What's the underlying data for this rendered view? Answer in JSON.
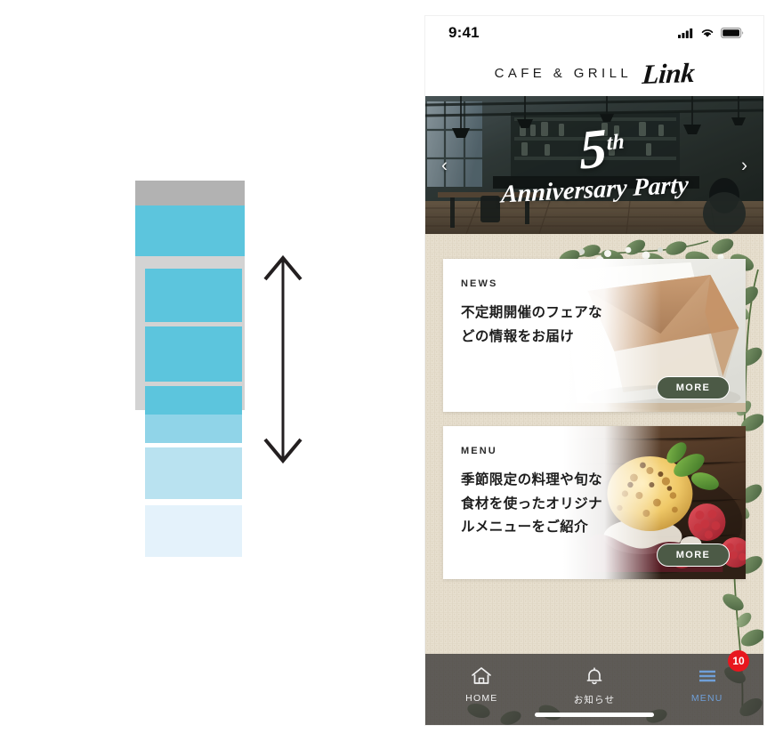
{
  "diagram": {
    "label": "scroll-depth-color-scale",
    "arrow": "double-headed-vertical-arrow",
    "blocks": [
      {
        "name": "gray-cap",
        "color": "#b2b2b2"
      },
      {
        "name": "blue-1",
        "color": "#5cc5dd"
      },
      {
        "name": "blue-2",
        "color": "#5cc5dd"
      },
      {
        "name": "blue-3",
        "color": "#5cc5dd"
      },
      {
        "name": "blue-4",
        "color": "#5cc5dd"
      },
      {
        "name": "blue-5",
        "color": "#90d4e8"
      },
      {
        "name": "blue-6",
        "color": "#b9e2f0"
      },
      {
        "name": "blue-7",
        "color": "#e4f2fb"
      }
    ],
    "backing_color": "#d3d3d3",
    "arrow_color": "#231f20"
  },
  "phone": {
    "statusbar": {
      "time": "9:41",
      "icons": [
        "cellular-signal-icon",
        "wifi-icon",
        "battery-icon"
      ]
    },
    "header": {
      "brand_prefix": "CAFE & GRILL",
      "brand_script": "Link"
    },
    "hero": {
      "number": "5",
      "ordinal": "th",
      "subtitle": "Anniversary Party",
      "prev_arrow": "‹",
      "next_arrow": "›"
    },
    "cards": [
      {
        "kicker": "NEWS",
        "title": "不定期開催のフェアなどの情報をお届け",
        "more_label": "MORE",
        "photo": "envelope-photo"
      },
      {
        "kicker": "MENU",
        "title": "季節限定の料理や旬な食材を使ったオリジナルメニューをご紹介",
        "more_label": "MORE",
        "photo": "dessert-photo"
      }
    ],
    "bottomnav": {
      "items": [
        {
          "label": "HOME",
          "icon": "home-icon",
          "active": false
        },
        {
          "label": "お知らせ",
          "icon": "bell-icon",
          "active": false
        },
        {
          "label": "MENU",
          "icon": "hamburger-menu-icon",
          "active": true
        }
      ],
      "badge_count": "10",
      "active_color": "#6f9fd8",
      "badge_color": "#e8171f"
    }
  }
}
